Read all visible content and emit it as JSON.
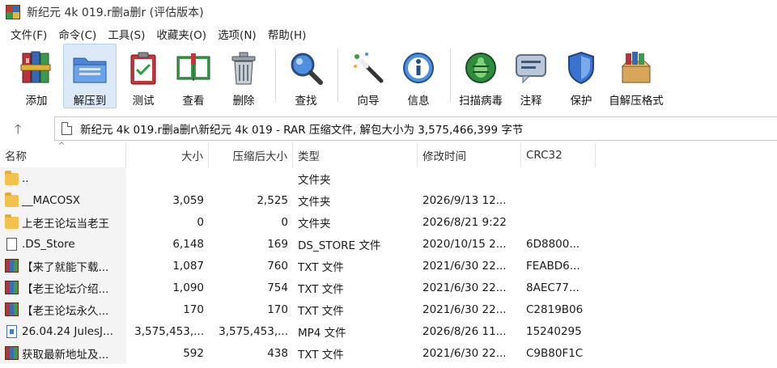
{
  "window": {
    "title": "新纪元 4k 019.r删a删r (评估版本)"
  },
  "menu": [
    "文件(F)",
    "命令(C)",
    "工具(S)",
    "收藏夹(O)",
    "选项(N)",
    "帮助(H)"
  ],
  "toolbar": {
    "add": "添加",
    "extract_to": "解压到",
    "test": "测试",
    "view": "查看",
    "delete": "删除",
    "find": "查找",
    "wizard": "向导",
    "info": "信息",
    "virus_scan": "扫描病毒",
    "comment": "注释",
    "protect": "保护",
    "sfx": "自解压格式"
  },
  "address": {
    "text": "新纪元 4k 019.r删a删r\\新纪元 4k 019 - RAR 压缩文件, 解包大小为 3,575,466,399 字节"
  },
  "columns": {
    "name": "名称",
    "size": "大小",
    "packed": "压缩后大小",
    "type": "类型",
    "modified": "修改时间",
    "crc": "CRC32"
  },
  "files": [
    {
      "icon": "folder",
      "name": "..",
      "size": "",
      "packed": "",
      "type": "文件夹",
      "modified": "",
      "crc": ""
    },
    {
      "icon": "folder",
      "name": "__MACOSX",
      "size": "3,059",
      "packed": "2,525",
      "type": "文件夹",
      "modified": "2026/9/13 12...",
      "crc": ""
    },
    {
      "icon": "folder",
      "name": "上老王论坛当老王",
      "size": "0",
      "packed": "0",
      "type": "文件夹",
      "modified": "2026/8/21 9:22",
      "crc": ""
    },
    {
      "icon": "file",
      "name": ".DS_Store",
      "size": "6,148",
      "packed": "169",
      "type": "DS_STORE 文件",
      "modified": "2020/10/15 2...",
      "crc": "6D8800..."
    },
    {
      "icon": "rar",
      "name": "【来了就能下载...",
      "size": "1,087",
      "packed": "760",
      "type": "TXT 文件",
      "modified": "2021/6/30 22...",
      "crc": "FEABD6..."
    },
    {
      "icon": "rar",
      "name": "【老王论坛介绍...",
      "size": "1,090",
      "packed": "754",
      "type": "TXT 文件",
      "modified": "2021/6/30 22...",
      "crc": "8AEC77..."
    },
    {
      "icon": "rar",
      "name": "【老王论坛永久...",
      "size": "170",
      "packed": "170",
      "type": "TXT 文件",
      "modified": "2021/6/30 22...",
      "crc": "C2819B06"
    },
    {
      "icon": "mp4",
      "name": "26.04.24 JulesJ...",
      "size": "3,575,453,...",
      "packed": "3,575,453,...",
      "type": "MP4 文件",
      "modified": "2026/8/26 11...",
      "crc": "15240295"
    },
    {
      "icon": "rar",
      "name": "获取最新地址及...",
      "size": "592",
      "packed": "438",
      "type": "TXT 文件",
      "modified": "2021/6/30 22...",
      "crc": "C9B80F1C"
    }
  ]
}
